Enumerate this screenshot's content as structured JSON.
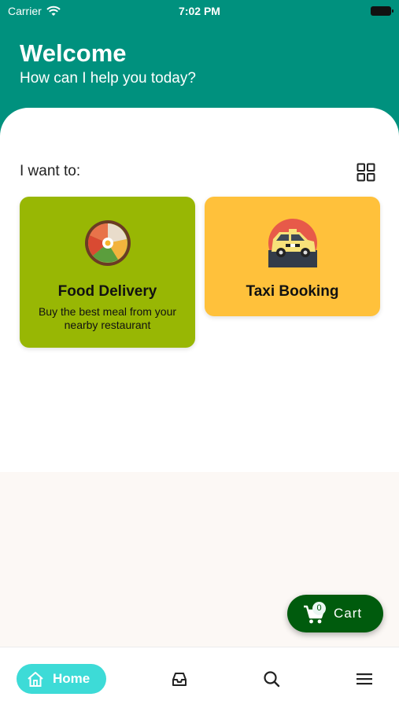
{
  "status": {
    "carrier": "Carrier",
    "time": "7:02 PM"
  },
  "header": {
    "title": "Welcome",
    "subtitle": "How can I help you today?"
  },
  "section": {
    "label": "I want to:"
  },
  "cards": [
    {
      "title": "Food Delivery",
      "description": "Buy the best meal from your nearby restaurant",
      "color": "#98b704",
      "icon": "food-bowl-icon"
    },
    {
      "title": "Taxi Booking",
      "description": "",
      "color": "#ffc13b",
      "icon": "taxi-icon"
    }
  ],
  "cart": {
    "count": "0",
    "label": "Cart"
  },
  "nav": {
    "home_label": "Home",
    "items": [
      "home-icon",
      "inbox-icon",
      "search-icon",
      "menu-icon"
    ]
  },
  "colors": {
    "header": "#00917e",
    "accent": "#3ddbd7",
    "cart": "#005b0d"
  }
}
